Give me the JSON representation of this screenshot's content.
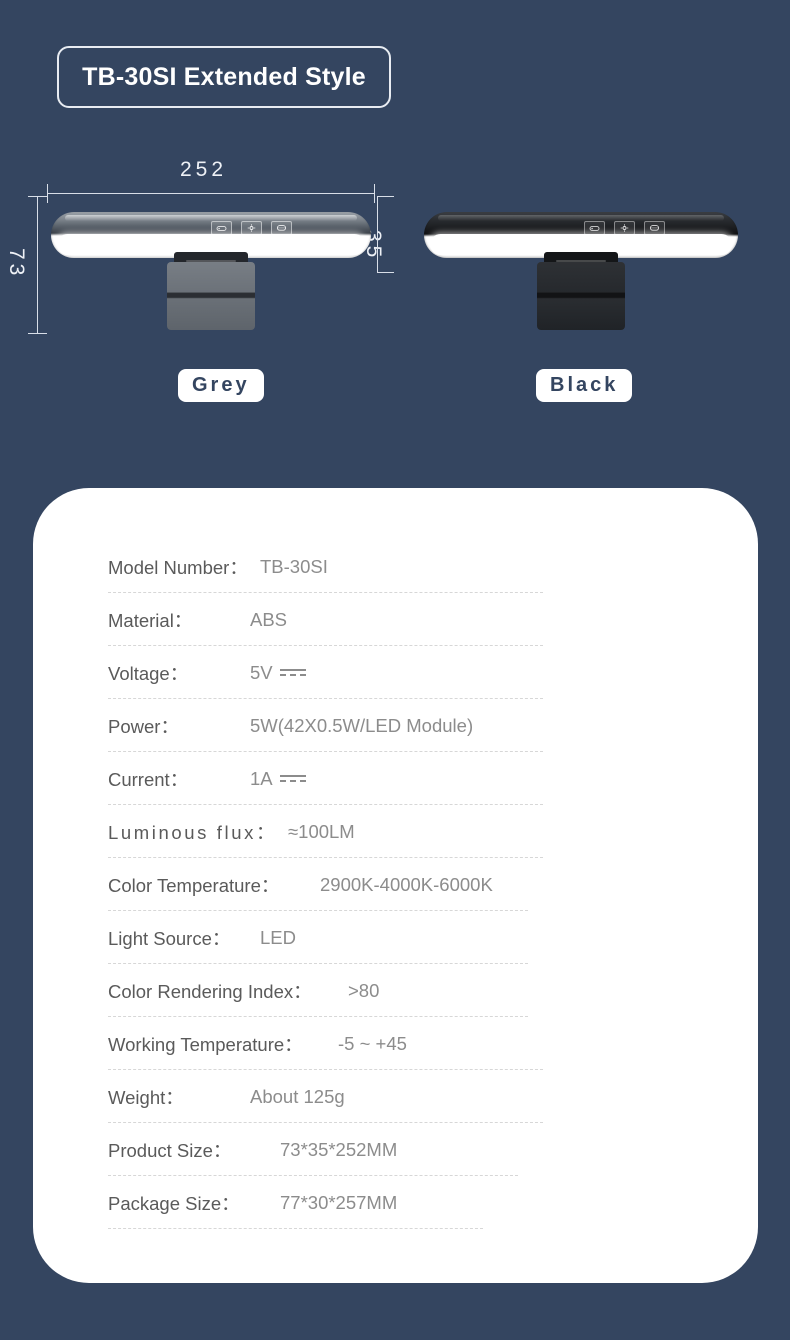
{
  "theme": {
    "background": "#344560",
    "card_background": "#ffffff",
    "badge_text": "#ffffff",
    "label_text": "#5a5a5a",
    "value_text": "#8c8c8c",
    "dimension_line": "#d8dee8"
  },
  "header": {
    "title": "TB-30SI Extended Style"
  },
  "hero": {
    "dimensions": {
      "width": "252",
      "height": "73",
      "depth": "35"
    },
    "products": [
      {
        "color_label": "Grey",
        "variant": "grey",
        "controls": [
          "power-icon",
          "brightness-icon",
          "color-temperature-icon"
        ]
      },
      {
        "color_label": "Black",
        "variant": "black",
        "controls": [
          "power-icon",
          "brightness-icon",
          "color-temperature-icon"
        ]
      }
    ]
  },
  "specs": {
    "rows": [
      {
        "label": "Model Number：",
        "value": "TB-30SI",
        "label_w": 152,
        "line_w": 435
      },
      {
        "label": "Material：",
        "value": "ABS",
        "label_w": 142,
        "line_w": 435
      },
      {
        "label": "Voltage：",
        "value": "5V",
        "label_w": 142,
        "line_w": 435,
        "dc": true
      },
      {
        "label": "Power：",
        "value": "5W(42X0.5W/LED Module)",
        "label_w": 142,
        "line_w": 435
      },
      {
        "label": "Current：",
        "value": "1A",
        "label_w": 142,
        "line_w": 435,
        "dc": true
      },
      {
        "label": "Luminous flux：",
        "value": "≈100LM",
        "label_w": 180,
        "line_w": 435,
        "track": "wide"
      },
      {
        "label": "Color Temperature：",
        "value": "2900K-4000K-6000K",
        "label_w": 212,
        "line_w": 420
      },
      {
        "label": "Light Source：",
        "value": "LED",
        "label_w": 152,
        "line_w": 420
      },
      {
        "label": "Color Rendering Index：",
        "value": ">80",
        "label_w": 240,
        "line_w": 420
      },
      {
        "label": "Working Temperature：",
        "value": "-5 ~ +45",
        "label_w": 230,
        "line_w": 435
      },
      {
        "label": "Weight：",
        "value": "About 125g",
        "label_w": 142,
        "line_w": 435
      },
      {
        "label": "Product Size：",
        "value": "73*35*252MM",
        "label_w": 172,
        "line_w": 410
      },
      {
        "label": "Package Size：",
        "value": "77*30*257MM",
        "label_w": 172,
        "line_w": 375
      }
    ]
  }
}
